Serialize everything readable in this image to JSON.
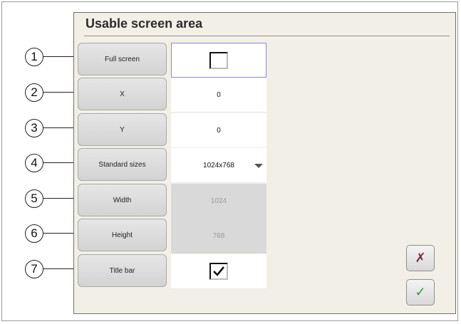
{
  "dialog": {
    "title": "Usable screen area"
  },
  "callouts": [
    "1",
    "2",
    "3",
    "4",
    "5",
    "6",
    "7"
  ],
  "rows": [
    {
      "label": "Full screen",
      "value": "",
      "checked": false
    },
    {
      "label": "X",
      "value": "0"
    },
    {
      "label": "Y",
      "value": "0"
    },
    {
      "label": "Standard sizes",
      "value": "1024x768"
    },
    {
      "label": "Width",
      "value": "1024"
    },
    {
      "label": "Height",
      "value": "768"
    },
    {
      "label": "Title bar",
      "value": "",
      "checked": true
    }
  ],
  "buttons": {
    "cancel_glyph": "✗",
    "cancel_color": "#7a2a4a",
    "confirm_glyph": "✓",
    "confirm_color": "#2aa02a"
  }
}
